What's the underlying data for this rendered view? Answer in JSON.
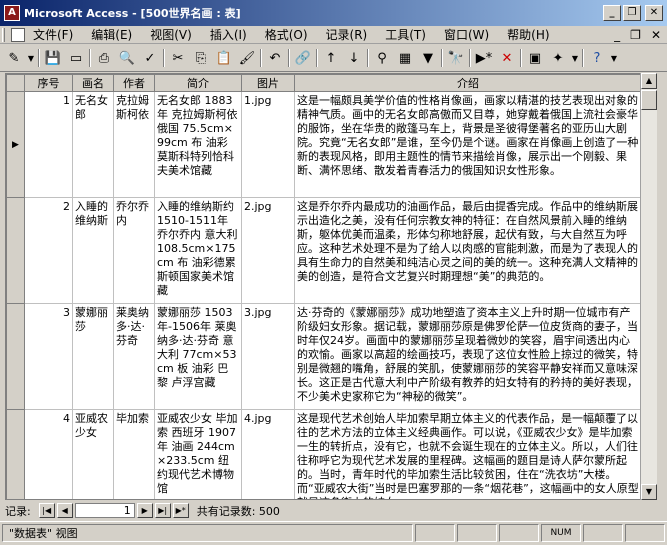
{
  "window": {
    "app_title": "Microsoft Access",
    "doc_title": "[500世界名画 : 表]",
    "separator": " - "
  },
  "menu": {
    "items": [
      "文件(F)",
      "编辑(E)",
      "视图(V)",
      "插入(I)",
      "格式(O)",
      "记录(R)",
      "工具(T)",
      "窗口(W)",
      "帮助(H)"
    ]
  },
  "columns": [
    "序号",
    "画名",
    "作者",
    "简介",
    "图片",
    "介绍"
  ],
  "rows": [
    {
      "id": "1",
      "name": "无名女郎",
      "author": "克拉姆斯柯依",
      "brief": "无名女郎 1883年 克拉姆斯柯依 俄国 75.5cm×99cm 布 油彩 莫斯科特列恰科夫美术馆藏",
      "image": "1.jpg",
      "intro": "这是一幅颇具美学价值的性格肖像画，画家以精湛的技艺表现出对象的精神气质。画中的无名女郎高傲而又目尊，她穿戴着俄国上流社会豪华的服饰，坐在华贵的敞篷马车上，背景是圣彼得堡著名的亚历山大剧院。究竟“无名女郎”是谁，至今仍是个谜。画家在肖像画上创造了一种新的表现风格，即用主题性的情节来描绘肖像，展示出一个刚毅、果断、满怀思绪、散发着青春活力的俄国知识女性形象。"
    },
    {
      "id": "2",
      "name": "入睡的维纳斯",
      "author": "乔尔乔内",
      "brief": "入睡的维纳斯约1510-1511年 乔尔乔内 意大利 108.5cm×175cm 布 油彩德累斯顿国家美术馆藏",
      "image": "2.jpg",
      "intro": "这是乔尔乔内最成功的油画作品，最后由提香完成。作品中的维纳斯展示出造化之美，没有任何宗教女神的特征：在自然风景前入睡的维纳斯，躯体优美而温柔，形体匀称地舒展，起伏有致，与大自然互为呼应。这种艺术处理不是为了给人以肉感的官能刺激，而是为了表现人的具有生命力的自然美和纯洁心灵之间的美的统一。这种充满人文精神的美的创造，是符合文艺复兴时期理想“美”的典范的。"
    },
    {
      "id": "3",
      "name": "蒙娜丽莎",
      "author": "莱奥纳多·达·芬奇",
      "brief": "蒙娜丽莎 1503年-1506年 莱奥纳多·达·芬奇 意大利 77cm×53cm 板 油彩 巴黎 卢浮宫藏",
      "image": "3.jpg",
      "intro": "达·芬奇的《蒙娜丽莎》成功地塑造了资本主义上升时期一位城市有产阶级妇女形象。据记载，蒙娜丽莎原是佛罗伦萨一位皮货商的妻子，当时年仅24岁。画面中的蒙娜丽莎呈现着微妙的笑容，眉宇间透出内心的欢愉。画家以高超的绘画技巧，表现了这位女性脸上掠过的微笑，特别是微翘的嘴角，舒展的笑肌，使蒙娜丽莎的笑容平静安祥而又意味深长。这正是古代意大利中产阶级有教养的妇女特有的矜持的美好表现，不少美术史家称它为“神秘的微笑”。"
    },
    {
      "id": "4",
      "name": "亚威农少女",
      "author": "毕加索",
      "brief": "亚威农少女 毕加索 西班牙 1907年 油画 244cm×233.5cm 纽约现代艺术博物馆",
      "image": "4.jpg",
      "intro": "这是现代艺术创始人毕加索早期立体主义的代表作品，是一幅颠覆了以往的艺术方法的立体主义经典画作。可以说，《亚威农少女》是毕加索一生的转折点，没有它，也就不会诞生现在的立体主义。所以，人们往往称呼它为现代艺术发展的里程碑。这幅画的题目是诗人萨尔蒙所起的。当时，青年时代的毕加索生活比较贫困，住在“洗衣坊”大楼。而“亚威农大街”当时是巴塞罗那的一条“烟花巷”，这幅画中的女人原型就是这条街上的妓女。"
    }
  ],
  "nav": {
    "label": "记录:",
    "current": "1",
    "total_text": "共有记录数: 500"
  },
  "status": {
    "view_text": "\"数据表\" 视图",
    "num": "NUM"
  }
}
